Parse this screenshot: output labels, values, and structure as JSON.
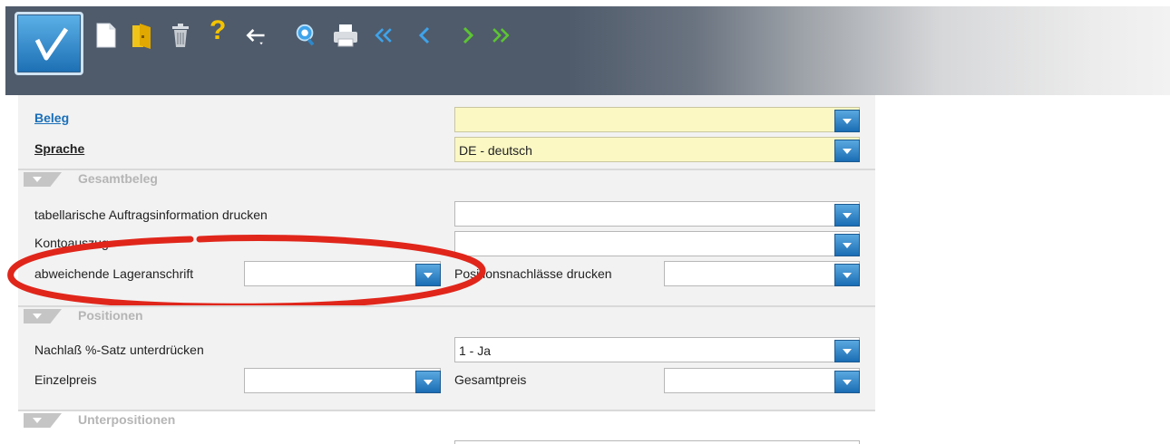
{
  "toolbar": {
    "icons": [
      "confirm-check-icon",
      "new-document-icon",
      "open-folder-icon",
      "delete-trash-icon",
      "help-icon",
      "back-arrow-icon",
      "search-icon",
      "print-icon",
      "first-record-icon",
      "previous-record-icon",
      "next-record-icon",
      "last-record-icon"
    ],
    "help_glyph": "?"
  },
  "header_fields": {
    "beleg_label": "Beleg",
    "beleg_value": "",
    "sprache_label": "Sprache",
    "sprache_value": "DE - deutsch"
  },
  "sections": {
    "gesamtbeleg": {
      "title": "Gesamtbeleg",
      "tabellarisch_label": "tabellarische Auftragsinformation drucken",
      "tabellarisch_value": "",
      "kontoauszug_label": "Kontoauszug",
      "kontoauszug_value": "",
      "lageranschrift_label": "abweichende Lageranschrift",
      "lageranschrift_value": "",
      "positionsnachlaesse_label": "Positionsnachlässe drucken",
      "positionsnachlaesse_value": ""
    },
    "positionen": {
      "title": "Positionen",
      "nachlass_label": "Nachlaß %-Satz unterdrücken",
      "nachlass_value": "1 - Ja",
      "einzelpreis_label": "Einzelpreis",
      "einzelpreis_value": "",
      "gesamtpreis_label": "Gesamtpreis",
      "gesamtpreis_value": ""
    },
    "unterpositionen": {
      "title": "Unterpositionen"
    }
  },
  "colors": {
    "accent_blue": "#1a6fb8",
    "required_yellow": "#fbf8c4",
    "highlight_red": "#e0261b"
  }
}
